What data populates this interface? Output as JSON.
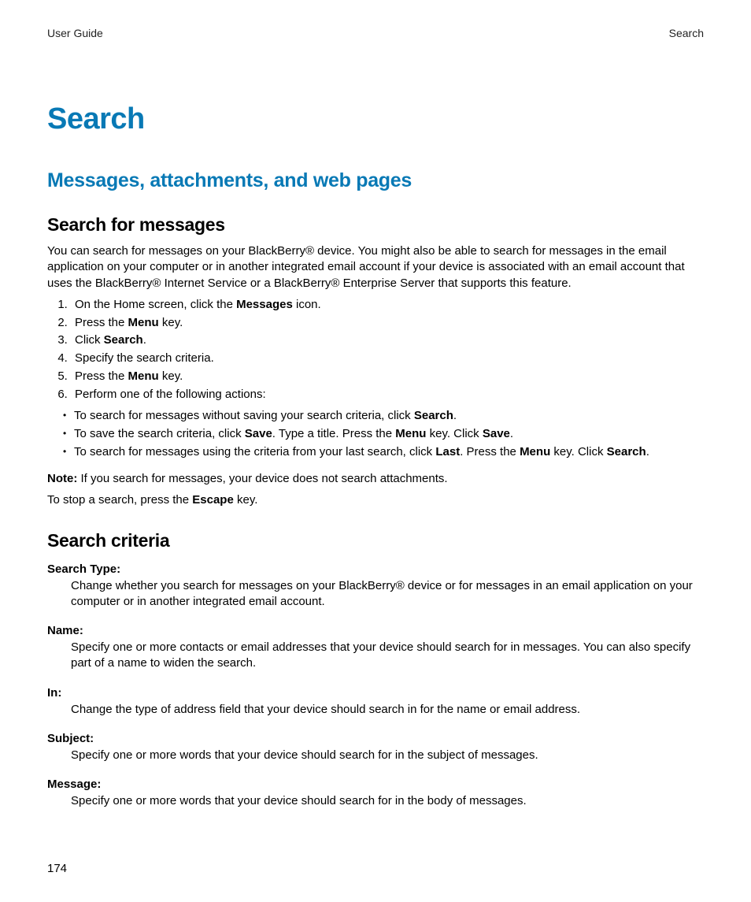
{
  "header": {
    "left": "User Guide",
    "right": "Search"
  },
  "title": "Search",
  "section": "Messages, attachments, and web pages",
  "sub1": {
    "heading": "Search for messages",
    "intro": "You can search for messages on your BlackBerry® device. You might also be able to search for messages in the email application on your computer or in another integrated email account if your device is associated with an email account that uses the BlackBerry® Internet Service or a BlackBerry® Enterprise Server that supports this feature.",
    "steps": [
      {
        "pre": "On the Home screen, click the ",
        "b": "Messages",
        "post": " icon."
      },
      {
        "pre": "Press the ",
        "b": "Menu",
        "post": " key."
      },
      {
        "pre": "Click ",
        "b": "Search",
        "post": "."
      },
      {
        "pre": "Specify the search criteria.",
        "b": "",
        "post": ""
      },
      {
        "pre": "Press the ",
        "b": "Menu",
        "post": " key."
      },
      {
        "pre": "Perform one of the following actions:",
        "b": "",
        "post": ""
      }
    ],
    "bullets": [
      {
        "parts": [
          "To search for messages without saving your search criteria, click ",
          "Search",
          "."
        ]
      },
      {
        "parts": [
          "To save the search criteria, click ",
          "Save",
          ". Type a title. Press the ",
          "Menu",
          " key. Click ",
          "Save",
          "."
        ]
      },
      {
        "parts": [
          "To search for messages using the criteria from your last search, click ",
          "Last",
          ". Press the ",
          "Menu",
          " key. Click ",
          "Search",
          "."
        ]
      }
    ],
    "note_label": "Note:",
    "note_text": "  If you search for messages, your device does not search attachments.",
    "stop_pre": "To stop a search, press the ",
    "stop_b": "Escape",
    "stop_post": " key."
  },
  "sub2": {
    "heading": "Search criteria",
    "items": [
      {
        "term": "Search Type:",
        "desc": "Change whether you search for messages on your BlackBerry® device or for messages in an email application on your computer or in another integrated email account."
      },
      {
        "term": "Name:",
        "desc": "Specify one or more contacts or email addresses that your device should search for in messages. You can also specify part of a name to widen the search."
      },
      {
        "term": "In:",
        "desc": "Change the type of address field that your device should search in for the name or email address."
      },
      {
        "term": "Subject:",
        "desc": "Specify one or more words that your device should search for in the subject of messages."
      },
      {
        "term": "Message:",
        "desc": "Specify one or more words that your device should search for in the body of messages."
      }
    ]
  },
  "page_number": "174"
}
